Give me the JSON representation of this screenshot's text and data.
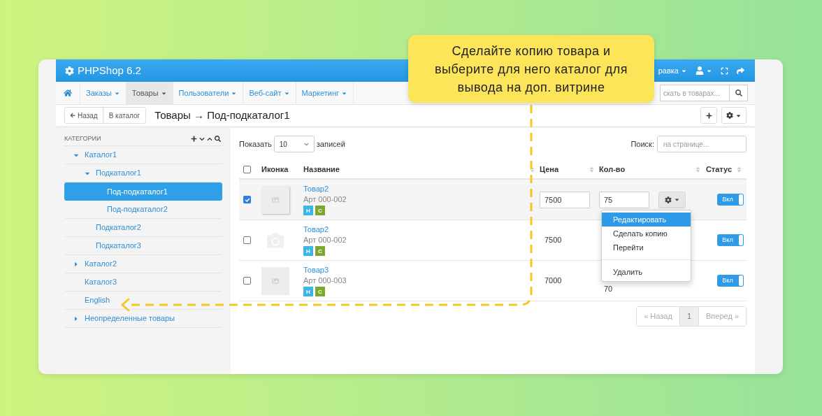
{
  "header": {
    "logo": "PHPShop 6.2",
    "menu_partial": "равка"
  },
  "nav": {
    "items": [
      {
        "label": "Заказы",
        "selected": false
      },
      {
        "label": "Товары",
        "selected": true
      },
      {
        "label": "Пользователи",
        "selected": false
      },
      {
        "label": "Веб-сайт",
        "selected": false
      },
      {
        "label": "Маркетинг",
        "selected": false
      }
    ],
    "search": {
      "placeholder": "скать в товарах..."
    }
  },
  "toolbar": {
    "back": "Назад",
    "catalog": "В каталог",
    "title": "Товары → Под-подкаталог1"
  },
  "sidebar": {
    "title": "КАТЕГОРИИ",
    "tree": [
      {
        "label": "Каталог1",
        "expanded": true,
        "selected": false,
        "children": [
          {
            "label": "Подкаталог1",
            "expanded": true,
            "selected": false,
            "children": [
              {
                "label": "Под-подкаталог1",
                "selected": true
              },
              {
                "label": "Под-подкаталог2",
                "selected": false
              }
            ]
          },
          {
            "label": "Подкаталог2",
            "selected": false
          },
          {
            "label": "Подкаталог3",
            "selected": false
          }
        ]
      },
      {
        "label": "Каталог2",
        "expanded": false,
        "selected": false
      },
      {
        "label": "Каталог3",
        "selected": false
      },
      {
        "label": "English",
        "selected": false
      },
      {
        "label": "Неопределенные товары",
        "expanded": false,
        "selected": false
      }
    ]
  },
  "table": {
    "all_checked": false,
    "show_label": "Показать",
    "length": "10",
    "records_label": "записей",
    "search_label": "Поиск:",
    "search_placeholder": "на странице...",
    "columns": [
      {
        "label": "Иконка",
        "sortable": false
      },
      {
        "label": "Название",
        "sortable": true
      },
      {
        "label": "Цена",
        "sortable": true
      },
      {
        "label": "Кол-во",
        "sortable": true
      },
      {
        "label": "Статус",
        "sortable": true
      }
    ],
    "rows": [
      {
        "selected": true,
        "has_image": true,
        "name": "Товар2",
        "sku": "Арт 000-002",
        "badges": [
          {
            "label": "Н",
            "color": "#3db5e6"
          },
          {
            "label": "С",
            "color": "#7aa92e"
          }
        ],
        "editing": true,
        "price": "7500",
        "qty": "75",
        "status": "Вкл",
        "on": true
      },
      {
        "selected": false,
        "has_image": false,
        "name": "Товар2",
        "sku": "Арт 000-002",
        "badges": [
          {
            "label": "Н",
            "color": "#3db5e6"
          },
          {
            "label": "С",
            "color": "#7aa92e"
          }
        ],
        "editing": false,
        "price": "7500",
        "status": "Вкл",
        "on": true
      },
      {
        "selected": false,
        "has_image": true,
        "name": "Товар3",
        "sku": "Арт 000-003",
        "badges": [
          {
            "label": "Н",
            "color": "#3db5e6"
          },
          {
            "label": "С",
            "color": "#7aa92e"
          }
        ],
        "editing": false,
        "price": "7000",
        "qty": "70",
        "status": "Вкл",
        "on": true
      }
    ],
    "menu": {
      "items": [
        {
          "kind": "item",
          "label": "Редактировать",
          "selected": true
        },
        {
          "kind": "item",
          "label": "Сделать копию",
          "selected": false
        },
        {
          "kind": "item",
          "label": "Перейти",
          "selected": false
        },
        {
          "kind": "divider"
        },
        {
          "kind": "item",
          "label": "Удалить",
          "selected": false
        }
      ]
    },
    "pagination": [
      {
        "label": "« Назад",
        "selected": false,
        "disabled": true
      },
      {
        "label": "1",
        "selected": true,
        "disabled": false
      },
      {
        "label": "Вперед »",
        "selected": false,
        "disabled": true
      }
    ]
  },
  "callout": {
    "text": "Сделайте копию товара и выберите для него каталог для вывода на доп. витрине"
  }
}
